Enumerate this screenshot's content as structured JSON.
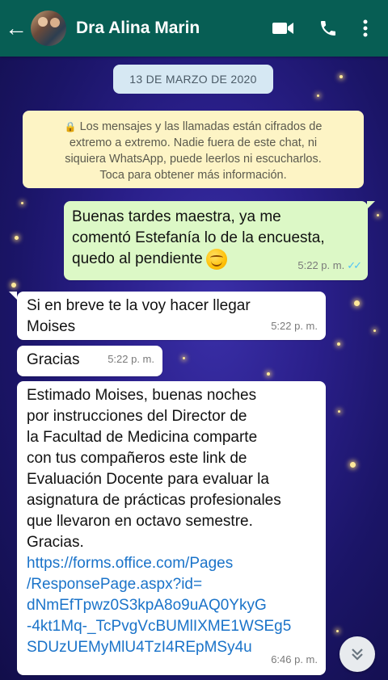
{
  "header": {
    "contact_name": "Dra Alina Marin",
    "back_icon": "arrow-left-icon",
    "avatar": "contact-avatar",
    "icons": [
      "video-call-icon",
      "phone-icon",
      "more-vert-icon"
    ]
  },
  "date_chip": "13 DE MARZO DE 2020",
  "encryption_notice": {
    "icon": "lock-icon",
    "lines": [
      "Los mensajes y las llamadas están cifrados de",
      "extremo a extremo. Nadie fuera de este chat, ni",
      "siquiera WhatsApp, puede leerlos ni escucharlos.",
      "Toca para obtener más información."
    ]
  },
  "messages": [
    {
      "direction": "outgoing",
      "lines": [
        "Buenas tardes maestra, ya me",
        "comentó Estefanía lo de la encuesta,",
        "quedo al pendiente"
      ],
      "emoji": "smiling-face-emoji",
      "time": "5:22 p. m.",
      "status": "read"
    },
    {
      "direction": "incoming",
      "lines": [
        "Si en breve te la voy hacer llegar",
        "Moises"
      ],
      "time": "5:22 p. m."
    },
    {
      "direction": "incoming",
      "lines": [
        "Gracias"
      ],
      "time": "5:22 p. m."
    },
    {
      "direction": "incoming",
      "lines": [
        "Estimado Moises, buenas noches",
        "por instrucciones del Director de",
        "la Facultad de Medicina comparte",
        "con tus compañeros este link de",
        "Evaluación Docente para evaluar la",
        "asignatura de prácticas profesionales",
        "que llevaron en octavo semestre.",
        "Gracias."
      ],
      "link_lines": [
        "https://forms.office.com/Pages",
        "/ResponsePage.aspx?id=",
        "dNmEfTpwz0S3kpA8o9uAQ0YkyG",
        "-4kt1Mq-_TcPvgVcBUMlIXME1WSEg5",
        "SDUzUEMyMlU4TzI4REpMSy4u"
      ],
      "time": "6:46 p. m."
    }
  ],
  "scroll_button_icon": "double-chevron-down-icon",
  "colors": {
    "header": "#075e54",
    "outgoing_bubble": "#dcf8c6",
    "incoming_bubble": "#ffffff",
    "link": "#1a73c9",
    "read_ticks": "#4fc3f7"
  }
}
